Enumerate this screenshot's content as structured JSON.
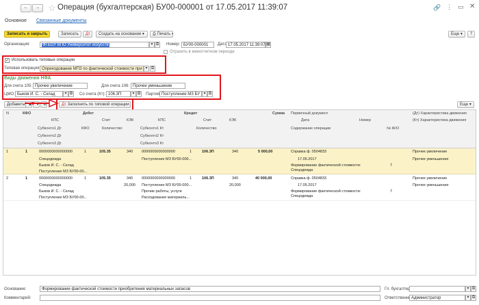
{
  "window": {
    "title": "Операция (бухгалтерская) БУ00-000001 от 17.05.2017 11:39:07",
    "tab_main": "Основное",
    "tab_related": "Связанные документы"
  },
  "toolbar": {
    "save_close": "Записать и закрыть",
    "save": "Записать",
    "create_basis": "Создать на основании",
    "print": "Печать",
    "more": "Еще"
  },
  "header": {
    "org_label": "Организация:",
    "org_value": "ФГБОУ ВПО Университет искусств",
    "num_label": "Номер:",
    "num_value": "БУ00-000001",
    "date_label": "Дата:",
    "date_value": "17.05.2017 11:39:07",
    "interperiod": "Отразить в межотчетном периоде"
  },
  "typical": {
    "checkbox_label": "Использовать типовые операции",
    "op_label": "Типовая операция:",
    "op_value": "Оприходование МПЗ по фактической стоимости при пр"
  },
  "nfa": {
    "title": "Виды движения НФА",
    "acc105_label": "Для счета 105:",
    "acc105_value": "Прочее увеличение",
    "acc106_label": "Для счета 106:",
    "acc106_value": "Прочее уменьшение",
    "mol_label": "ЦМО:",
    "mol_value": "Быков И. С. - Склад",
    "from_acc_label": "Со счета (Кт):",
    "from_acc_value": "106.3П",
    "batch_label": "Партия:",
    "batch_value": "Поступление МЗ БУ"
  },
  "tabletools": {
    "add": "Добавить",
    "fill": "Заполнить по типовой операции",
    "more": "Еще"
  },
  "table": {
    "h_n": "N",
    "h_kfo": "КФО",
    "h_debit": "Дебет",
    "h_credit": "Кредит",
    "h_sum": "Сумма",
    "h_primary": "Первичный документ",
    "h_dt_char": "(Дт) Характеристика движения",
    "h_kps": "КПС",
    "h_acc": "Счет",
    "h_kek": "КЭК",
    "h_date": "Дата",
    "h_number": "Номер",
    "h_kt_char": "(Кт) Характеристика движения",
    "h_sub1dt": "Субконто1 Дт",
    "h_kfo2": "КФО",
    "h_qty": "Количество",
    "h_sub1kt": "Субконто1 Кт",
    "h_qty2": "Количество",
    "h_content": "Содержание операции",
    "h_jnum": "№ Ж/О",
    "h_sub2dt": "Субконто2 Дт",
    "h_sub2kt": "Субконто2 Кт",
    "h_sub3dt": "Субконто3 Дт",
    "h_sub3kt": "Субконто3 Кт",
    "rows": [
      {
        "n": "1",
        "kfo": "1",
        "dt_kps": "0000000000000000",
        "dt_kfo": "1",
        "dt_acc": "105.35",
        "dt_kek": "340",
        "kt_kps": "0000000000000000",
        "kt_kfo": "1",
        "kt_acc": "106.3П",
        "kt_kek": "340",
        "sum": "5 000,00",
        "doc": "Справка ф. 0504833",
        "doc_date": "17.05.2017",
        "dt_char": "Прочее увеличение",
        "kt_char": "Прочее уменьшение",
        "dt_sub1": "Спецодежда",
        "kt_sub1": "Поступление МЗ БУ00-000...",
        "dt_sub2": "Быков И. С. - Склад",
        "dt_sub3": "Поступление МЗ БУ00-00...",
        "content": "Формирование фактической стоимости: Спецодежда",
        "jnum": "7"
      },
      {
        "n": "2",
        "kfo": "1",
        "dt_kps": "0000000000000000",
        "dt_kfo": "1",
        "dt_acc": "105.35",
        "dt_kek": "340",
        "dt_kek2": "20,000",
        "kt_kps": "0000000000000000",
        "kt_kfo": "1",
        "kt_acc": "106.3П",
        "kt_kek": "340",
        "kt_kek2": "20,000",
        "sum": "40 000,00",
        "doc": "Справка ф. 0504833",
        "doc_date": "17.05.2017",
        "dt_char": "Прочее увеличение",
        "kt_char": "Прочее уменьшение",
        "dt_sub1": "Спецодежда",
        "kt_sub1": "Поступление МЗ БУ00-000...",
        "kt_sub2": "Прочие работы, услуги",
        "dt_sub2": "Быков И. С. - Склад",
        "dt_sub3": "Поступление МЗ БУ00-00...",
        "kt_sub3": "Расходование материаль...",
        "content": "Формирование фактической стоимости: Спецодежда",
        "jnum": "7"
      }
    ]
  },
  "footer": {
    "basis_label": "Основание:",
    "basis_value": "Формирование фактической стоимости приобретения материальных запасов",
    "chief_label": "Гл. бухгалтер:",
    "comment_label": "Комментарий:",
    "resp_label": "Ответственный:",
    "resp_value": "Администратор"
  },
  "colors": {
    "accent_yellow": "#f5d92b",
    "red": "#e0151b",
    "selected_row": "#fbf3c7",
    "green_title": "#2d7d2d"
  }
}
